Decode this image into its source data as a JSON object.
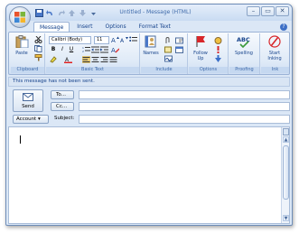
{
  "window": {
    "title": "Untitled - Message (HTML)",
    "controls": [
      "minimize-icon",
      "restore-icon",
      "close-icon"
    ]
  },
  "ribbon_tabs": [
    "Message",
    "Insert",
    "Options",
    "Format Text"
  ],
  "active_tab": "Message",
  "ribbon": {
    "clipboard": {
      "paste_label": "Paste",
      "group_label": "Clipboard"
    },
    "basic_text": {
      "font_value": "Calibri (Body)",
      "size_value": "11",
      "bold": "B",
      "italic": "I",
      "underline": "U",
      "group_label": "Basic Text"
    },
    "names": {
      "names_label": "Names"
    },
    "include": {
      "group_label": "Include"
    },
    "options": {
      "follow_up_label": "Follow",
      "follow_up_label2": "Up",
      "group_label": "Options"
    },
    "proofing": {
      "spelling_label": "Spelling",
      "group_label": "Proofing"
    },
    "ink": {
      "start_inking_label": "Start",
      "start_inking_label2": "Inking",
      "group_label": "Ink"
    }
  },
  "infobar": {
    "text": "This message has not been sent."
  },
  "header": {
    "send_label": "Send",
    "to_label": "To...",
    "cc_label": "Cc...",
    "account_label": "Account",
    "subject_label": "Subject:",
    "to_value": "",
    "cc_value": "",
    "subject_value": ""
  },
  "colors": {
    "accent": "#15428b",
    "ribbon_bg": "#dfeaf7",
    "window_bg": "#dbe7f6"
  }
}
